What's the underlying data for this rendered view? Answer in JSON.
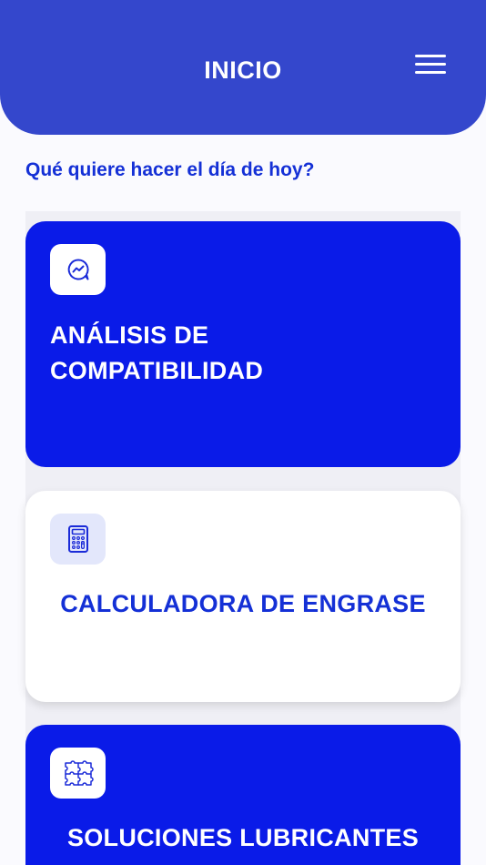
{
  "header": {
    "title": "INICIO",
    "menu_icon": "hamburger-menu-icon",
    "background": "#3447cc"
  },
  "prompt": "Qué quiere hacer el día de hoy?",
  "cards": [
    {
      "title_lines": [
        "ANÁLISIS DE",
        "COMPATIBILIDAD"
      ],
      "icon": "chat-chart-icon",
      "style": "blue",
      "background": "#0a1be8"
    },
    {
      "title": "CALCULADORA DE ENGRASE",
      "icon": "calculator-icon",
      "style": "white",
      "background": "#ffffff"
    },
    {
      "title": "SOLUCIONES LUBRICANTES",
      "icon": "puzzle-icon",
      "style": "blue",
      "background": "#0a1be8"
    }
  ],
  "colors": {
    "accent": "#1430d6",
    "primary_card": "#0a1be8"
  }
}
